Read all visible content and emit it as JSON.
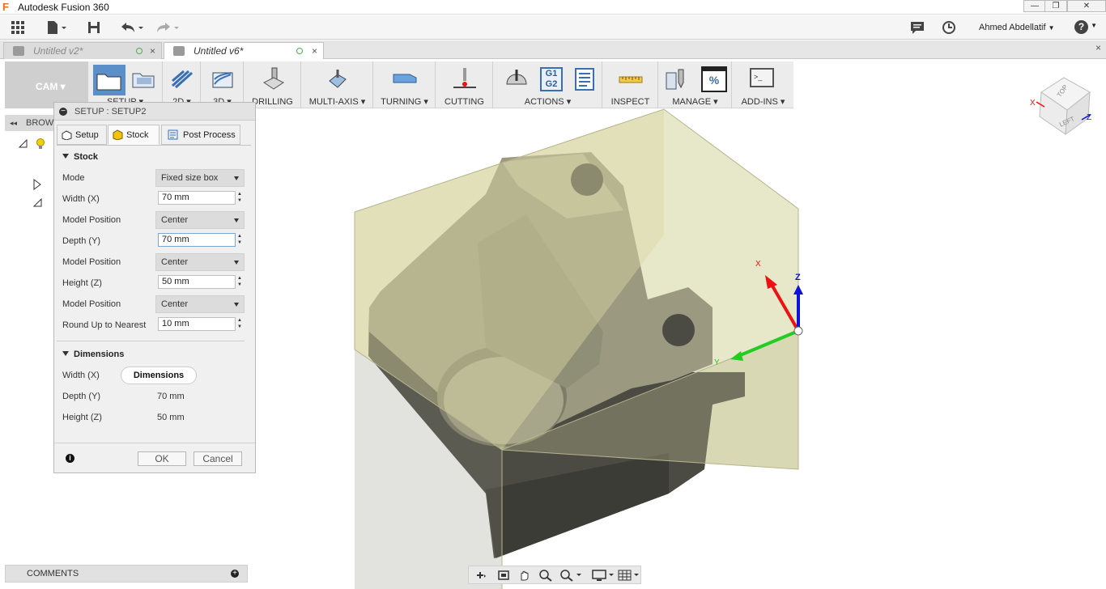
{
  "window": {
    "app_title": "Autodesk Fusion 360",
    "user": "Ahmed Abdellatif",
    "user_caret": "▼",
    "help": "?",
    "help_caret": "▼",
    "minimize": "—",
    "restore": "❐",
    "close": "✕"
  },
  "doc_tabs": [
    {
      "label": "Untitled v2*",
      "active": false
    },
    {
      "label": "Untitled v6*",
      "active": true
    }
  ],
  "tab_close": "×",
  "ribbon": {
    "workspace": "CAM ▾",
    "groups": [
      {
        "label": "SETUP ▾"
      },
      {
        "label": "2D ▾"
      },
      {
        "label": "3D ▾"
      },
      {
        "label": "DRILLING"
      },
      {
        "label": "MULTI-AXIS ▾"
      },
      {
        "label": "TURNING ▾"
      },
      {
        "label": "CUTTING"
      },
      {
        "label": "ACTIONS ▾"
      },
      {
        "label": "INSPECT"
      },
      {
        "label": "MANAGE ▾"
      },
      {
        "label": "ADD-INS ▾"
      }
    ],
    "actions_code": [
      "G1",
      "G2"
    ],
    "manage_percent": "%",
    "addins_prompt": ">_"
  },
  "browser": {
    "label": "BROWSER",
    "collapse": "◂◂"
  },
  "setup_panel": {
    "title": "SETUP : SETUP2",
    "tabs": [
      "Setup",
      "Stock",
      "Post Process"
    ],
    "active_tab": "Stock",
    "stock_section": "Stock",
    "stock_fields": [
      {
        "label": "Mode",
        "type": "select",
        "value": "Fixed size box"
      },
      {
        "label": "Width (X)",
        "type": "number",
        "value": "70 mm"
      },
      {
        "label": "Model Position",
        "type": "select",
        "value": "Center"
      },
      {
        "label": "Depth (Y)",
        "type": "number",
        "value": "70 mm"
      },
      {
        "label": "Model Position",
        "type": "select",
        "value": "Center"
      },
      {
        "label": "Height (Z)",
        "type": "number",
        "value": "50 mm"
      },
      {
        "label": "Model Position",
        "type": "select",
        "value": "Center"
      },
      {
        "label": "Round Up to Nearest",
        "type": "number",
        "value": "10 mm"
      }
    ],
    "dimensions_section": "Dimensions",
    "dimensions": {
      "width_label": "Width (X)",
      "width_tooltip": "Dimensions",
      "depth_label": "Depth (Y)",
      "depth_value": "70 mm",
      "height_label": "Height (Z)",
      "height_value": "50 mm"
    },
    "ok": "OK",
    "cancel": "Cancel",
    "info": "i"
  },
  "comments": {
    "label": "COMMENTS",
    "plus": "+"
  },
  "viewcube": {
    "top": "TOP",
    "left": "LEFT",
    "x": "X",
    "z": "Z"
  },
  "triad": {
    "x": "X",
    "y": "Y",
    "z": "Z"
  },
  "colors": {
    "stock": "#d8d8a6",
    "part": "#4a4a43",
    "x_axis": "#e11",
    "y_axis": "#2c2",
    "z_axis": "#11d",
    "accent": "#3a6fb5"
  }
}
